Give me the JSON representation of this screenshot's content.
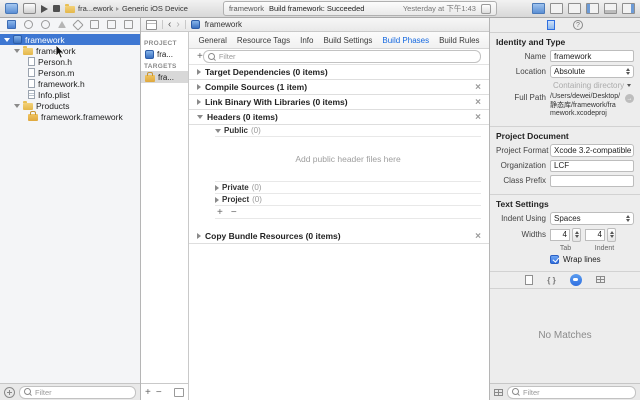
{
  "toolbar": {
    "scheme_name": "fra...ework",
    "device": "Generic iOS Device",
    "status_left": "framework",
    "status_build": "Build framework: Succeeded",
    "status_time": "Yesterday at 下午1:43"
  },
  "navigator": {
    "items": [
      {
        "label": "framework"
      },
      {
        "label": "framework"
      },
      {
        "label": "Person.h"
      },
      {
        "label": "Person.m"
      },
      {
        "label": "framework.h"
      },
      {
        "label": "Info.plist"
      },
      {
        "label": "Products"
      },
      {
        "label": "framework.framework"
      }
    ],
    "filter_placeholder": "Filter"
  },
  "jumpbar": {
    "crumb": "framework"
  },
  "editor": {
    "sidebar": {
      "project_header": "PROJECT",
      "project_item": "fra...",
      "targets_header": "TARGETS",
      "targets_item": "fra..."
    },
    "tabs": [
      {
        "label": "General"
      },
      {
        "label": "Resource Tags"
      },
      {
        "label": "Info"
      },
      {
        "label": "Build Settings"
      },
      {
        "label": "Build Phases"
      },
      {
        "label": "Build Rules"
      }
    ],
    "filter_placeholder": "Filter",
    "phases": [
      {
        "title": "Target Dependencies (0 items)"
      },
      {
        "title": "Compile Sources (1 item)"
      },
      {
        "title": "Link Binary With Libraries (0 items)"
      },
      {
        "title": "Headers (0 items)"
      },
      {
        "title": "Copy Bundle Resources (0 items)"
      }
    ],
    "headers_section": {
      "public_label": "Public",
      "public_count": "(0)",
      "hint": "Add public header files here",
      "private_label": "Private",
      "private_count": "(0)",
      "project_label": "Project",
      "project_count": "(0)"
    }
  },
  "inspector": {
    "identity_title": "Identity and Type",
    "name_label": "Name",
    "name_value": "framework",
    "location_label": "Location",
    "location_value": "Absolute",
    "containing_dir_label": "Containing directory",
    "full_path_label": "Full Path",
    "full_path_value": "/Users/dewei/Desktop/静态库/framework/framework.xcodeproj",
    "document_title": "Project Document",
    "format_label": "Project Format",
    "format_value": "Xcode 3.2-compatible",
    "organization_label": "Organization",
    "organization_value": "LCF",
    "class_prefix_label": "Class Prefix",
    "text_title": "Text Settings",
    "indent_label": "Indent Using",
    "indent_value": "Spaces",
    "widths_label": "Widths",
    "tab_width": "4",
    "indent_width": "4",
    "tab_caption": "Tab",
    "indent_caption": "Indent",
    "wrap_label": "Wrap lines",
    "library_empty": "No Matches",
    "filter_placeholder": "Filter"
  }
}
